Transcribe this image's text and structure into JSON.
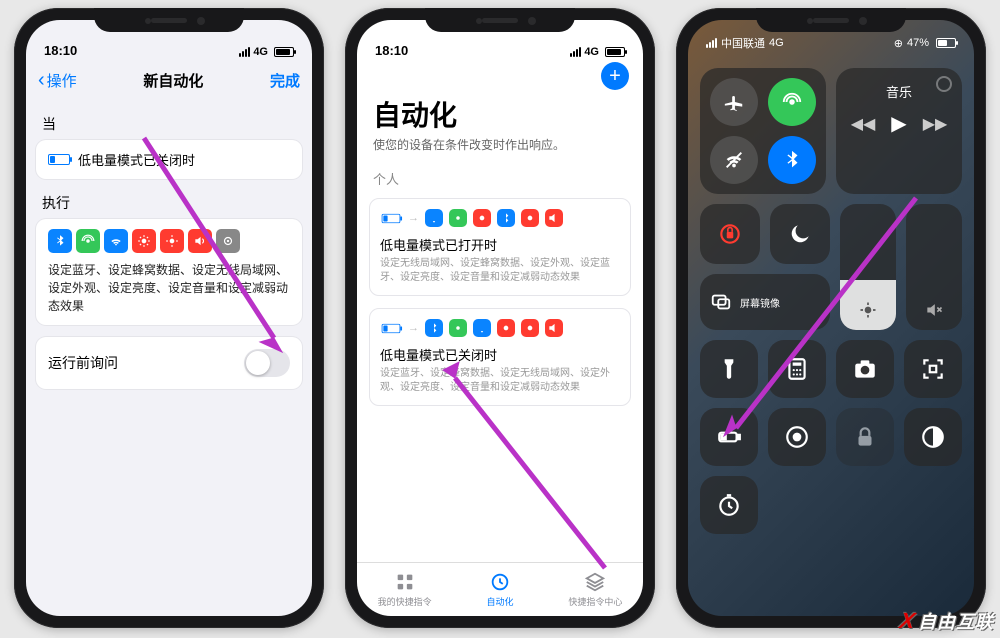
{
  "phone1": {
    "status": {
      "time": "18:10",
      "net": "4G"
    },
    "nav": {
      "back": "操作",
      "title": "新自动化",
      "done": "完成"
    },
    "section_when": "当",
    "condition": "低电量模式已关闭时",
    "section_do": "执行",
    "action_icons": [
      "bluetooth",
      "cellular",
      "wifi",
      "brightness",
      "brightness",
      "volume",
      "haptic"
    ],
    "action_desc": "设定蓝牙、设定蜂窝数据、设定无线局域网、设定外观、设定亮度、设定音量和设定减弱动态效果",
    "ask_label": "运行前询问",
    "ask_on": false
  },
  "phone2": {
    "status": {
      "time": "18:10",
      "net": "4G"
    },
    "title": "自动化",
    "subtitle": "使您的设备在条件改变时作出响应。",
    "section": "个人",
    "automations": [
      {
        "condition_icon": "battery-low",
        "action_icons": [
          "wifi",
          "cellular",
          "brightness",
          "bluetooth",
          "brightness",
          "volume"
        ],
        "title": "低电量模式已打开时",
        "desc": "设定无线局域网、设定蜂窝数据、设定外观、设定蓝牙、设定亮度、设定音量和设定减弱动态效果"
      },
      {
        "condition_icon": "battery-low",
        "action_icons": [
          "bluetooth",
          "cellular",
          "wifi",
          "brightness",
          "brightness",
          "volume"
        ],
        "title": "低电量模式已关闭时",
        "desc": "设定蓝牙、设定蜂窝数据、设定无线局域网、设定外观、设定亮度、设定音量和设定减弱动态效果"
      }
    ],
    "tabs": [
      {
        "label": "我的快捷指令",
        "icon": "grid",
        "active": false
      },
      {
        "label": "自动化",
        "icon": "clock",
        "active": true
      },
      {
        "label": "快捷指令中心",
        "icon": "layers",
        "active": false
      }
    ]
  },
  "phone3": {
    "status": {
      "carrier": "中国联通",
      "net": "4G",
      "battery_pct": "47%"
    },
    "music_label": "音乐",
    "mirror_label": "屏幕镜像",
    "connectivity": [
      {
        "name": "airplane",
        "state": "off"
      },
      {
        "name": "cellular",
        "state": "green"
      },
      {
        "name": "wifi",
        "state": "off"
      },
      {
        "name": "bluetooth",
        "state": "blue"
      }
    ],
    "row2_toggles": [
      {
        "name": "rotation-lock",
        "glyph": "lock-rotation"
      },
      {
        "name": "do-not-disturb",
        "glyph": "moon"
      }
    ],
    "grid": [
      {
        "name": "flashlight"
      },
      {
        "name": "calculator"
      },
      {
        "name": "camera"
      },
      {
        "name": "qr-scan"
      },
      {
        "name": "low-power"
      },
      {
        "name": "record"
      },
      {
        "name": "lock"
      },
      {
        "name": "dark-mode"
      },
      {
        "name": "timer"
      }
    ]
  },
  "watermark": "自由互联",
  "colors": {
    "ios_blue": "#007aff",
    "ios_green": "#34c759",
    "ios_red": "#ff3b30",
    "tile_blue": "#0a84ff",
    "tile_green": "#34c759",
    "tile_red": "#ff3b30",
    "tile_orange": "#ff9500",
    "arrow": "#b932c7"
  }
}
